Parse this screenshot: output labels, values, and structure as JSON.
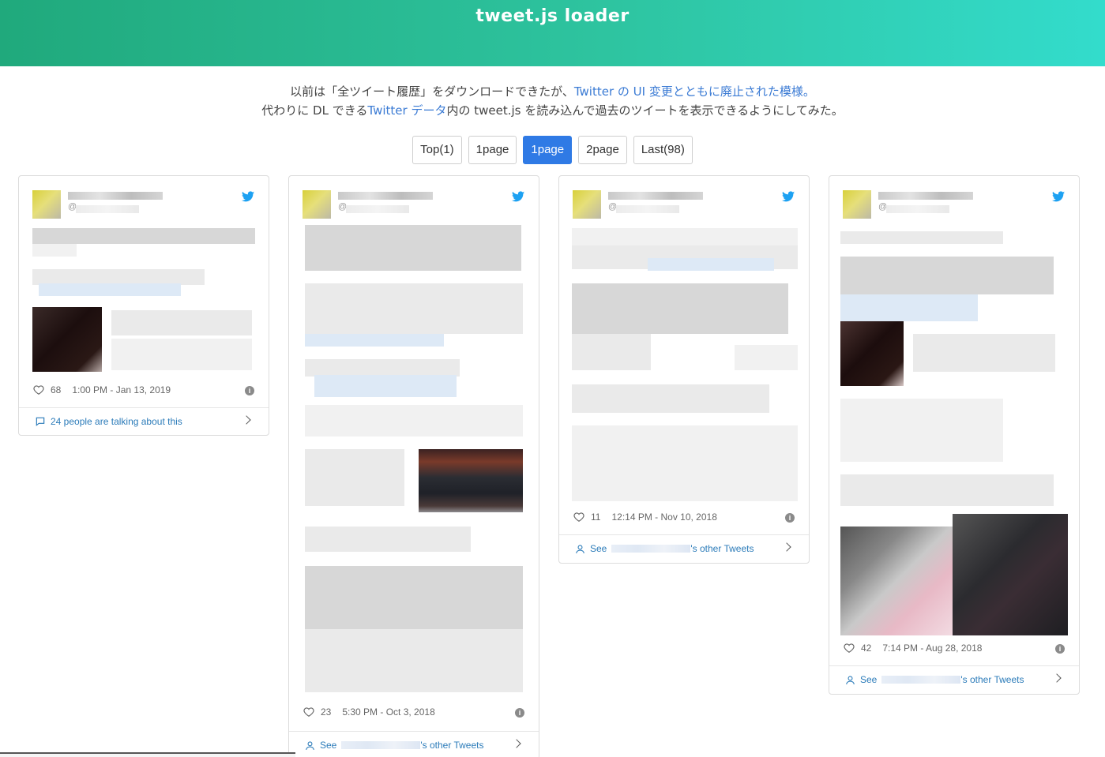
{
  "header": {
    "title": "tweet.js loader"
  },
  "intro": {
    "line1_prefix": "以前は「全ツイート履歴」をダウンロードできたが、",
    "line1_link": "Twitter の UI 変更とともに廃止された模様。",
    "line2_prefix": "代わりに DL できる",
    "line2_link": "Twitter データ",
    "line2_suffix": "内の tweet.js を読み込んで過去のツイートを表示できるようにしてみた。"
  },
  "pager": {
    "items": [
      "Top(1)",
      "1page",
      "1page",
      "2page",
      "Last(98)"
    ],
    "active_index": 2,
    "active_color": "#2f7ae5"
  },
  "tweets": [
    {
      "handle_prefix": "@",
      "likes": "68",
      "timestamp": "1:00 PM - Jan 13, 2019",
      "cta": "24 people are talking about this",
      "cta_icon": "speech-bubble-icon"
    },
    {
      "handle_prefix": "@",
      "likes": "23",
      "timestamp": "5:30 PM - Oct 3, 2018",
      "cta_prefix": "See",
      "cta_suffix": "'s other Tweets",
      "cta_icon": "person-icon"
    },
    {
      "handle_prefix": "@",
      "likes": "11",
      "timestamp": "12:14 PM - Nov 10, 2018",
      "cta_prefix": "See",
      "cta_suffix": "'s other Tweets",
      "cta_icon": "person-icon"
    },
    {
      "handle_prefix": "@",
      "likes": "42",
      "timestamp": "7:14 PM - Aug 28, 2018",
      "cta_prefix": "See",
      "cta_suffix": "'s other Tweets",
      "cta_icon": "person-icon"
    }
  ],
  "colors": {
    "header_start": "#20a97c",
    "header_end": "#33dccc",
    "link": "#3b7bd4",
    "twitter_blue": "#1da1f2"
  }
}
